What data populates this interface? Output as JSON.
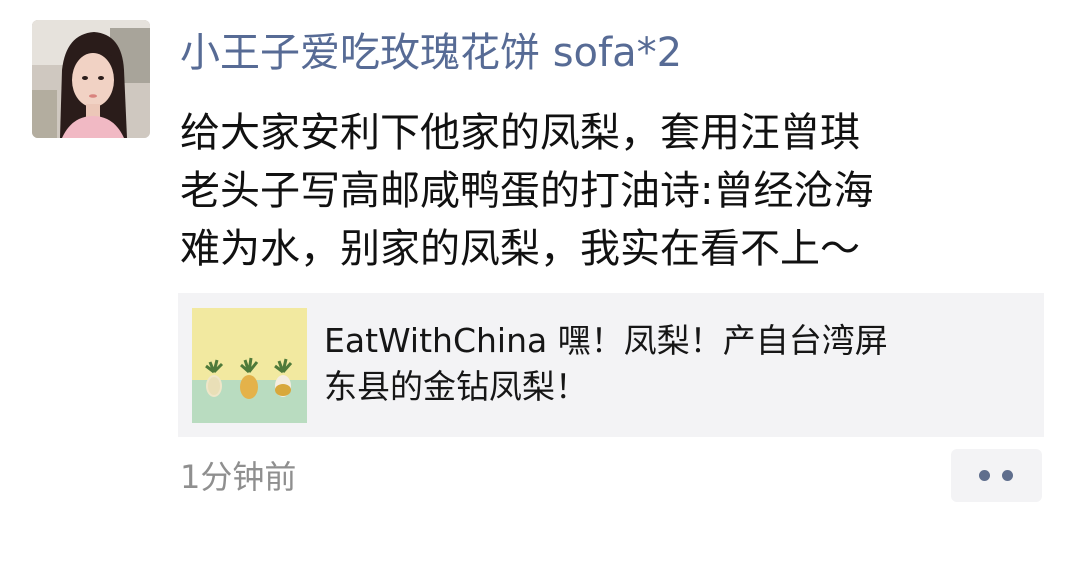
{
  "post": {
    "username": "小王子爱吃玫瑰花饼 sofa*2",
    "body_lines": [
      "给大家安利下他家的凤梨，套用汪曾琪",
      "老头子写高邮咸鸭蛋的打油诗:曾经沧海",
      "难为水，别家的凤梨，我实在看不上～"
    ],
    "share": {
      "lines": [
        "EatWithChina 嘿！凤梨！产自台湾屏",
        "东县的金钻凤梨！"
      ]
    },
    "timestamp": "1分钟前"
  },
  "icons": {
    "more": "more-dots-icon",
    "avatar": "avatar-photo",
    "thumbnail": "pineapple-thumbnail"
  },
  "colors": {
    "username": "#576b95",
    "body_text": "#111111",
    "timestamp": "#8f8f8f",
    "card_bg": "#f3f3f5",
    "dots": "#5f6e8d"
  }
}
